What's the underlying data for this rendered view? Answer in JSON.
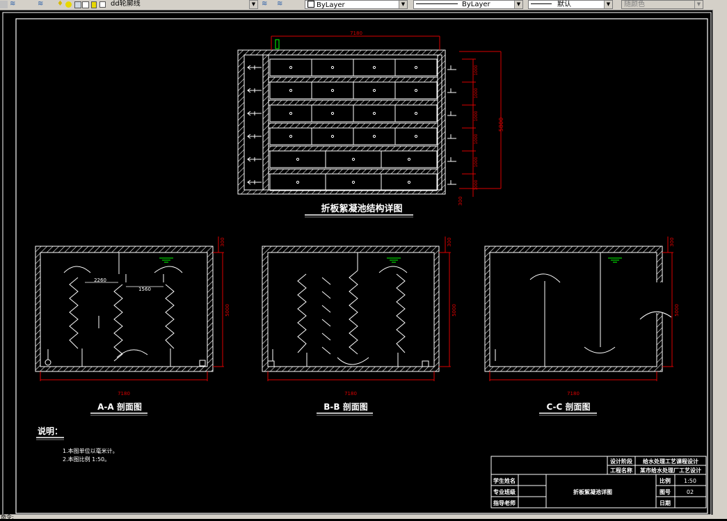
{
  "toolbar": {
    "layer_name": "dd轮廓线",
    "color": "ByLayer",
    "linetype": "ByLayer",
    "lineweight": "默认",
    "plotstyle": "随颜色"
  },
  "drawing": {
    "plan_title": "折板絮凝池结构详图",
    "plan_width_dim": "7180",
    "plan_total_dim": "5800",
    "plan_side_dims": [
      "1000",
      "1000",
      "1000",
      "1000",
      "1000",
      "1000"
    ],
    "plan_bottom_dim": "300",
    "sections": [
      {
        "label": "A-A 剖面图",
        "width_dim": "7180",
        "height_dim": "5000",
        "top_dim": "300",
        "dim_a": "2260",
        "dim_b": "1560"
      },
      {
        "label": "B-B 剖面图",
        "width_dim": "7180",
        "height_dim": "5000",
        "top_dim": "300"
      },
      {
        "label": "C-C 剖面图",
        "width_dim": "7180",
        "height_dim": "5000",
        "top_dim": "300"
      }
    ],
    "notes_title": "说明：",
    "notes": [
      "1.本图单位以毫米计。",
      "2.本图比例 1:50。"
    ]
  },
  "title_block": {
    "design_label": "设计阶段",
    "design_value": "给水处理工艺课程设计",
    "project_label": "工程名称",
    "project_value": "某市给水处理厂工艺设计",
    "student_label": "学生姓名",
    "class_label": "专业班级",
    "teacher_label": "指导老师",
    "drawing_name": "折板絮凝池详图",
    "scale_label": "比例",
    "scale_value": "1:50",
    "sheet_label": "图号",
    "sheet_value": "02",
    "date_label": "日期"
  },
  "command_line": "命令:"
}
